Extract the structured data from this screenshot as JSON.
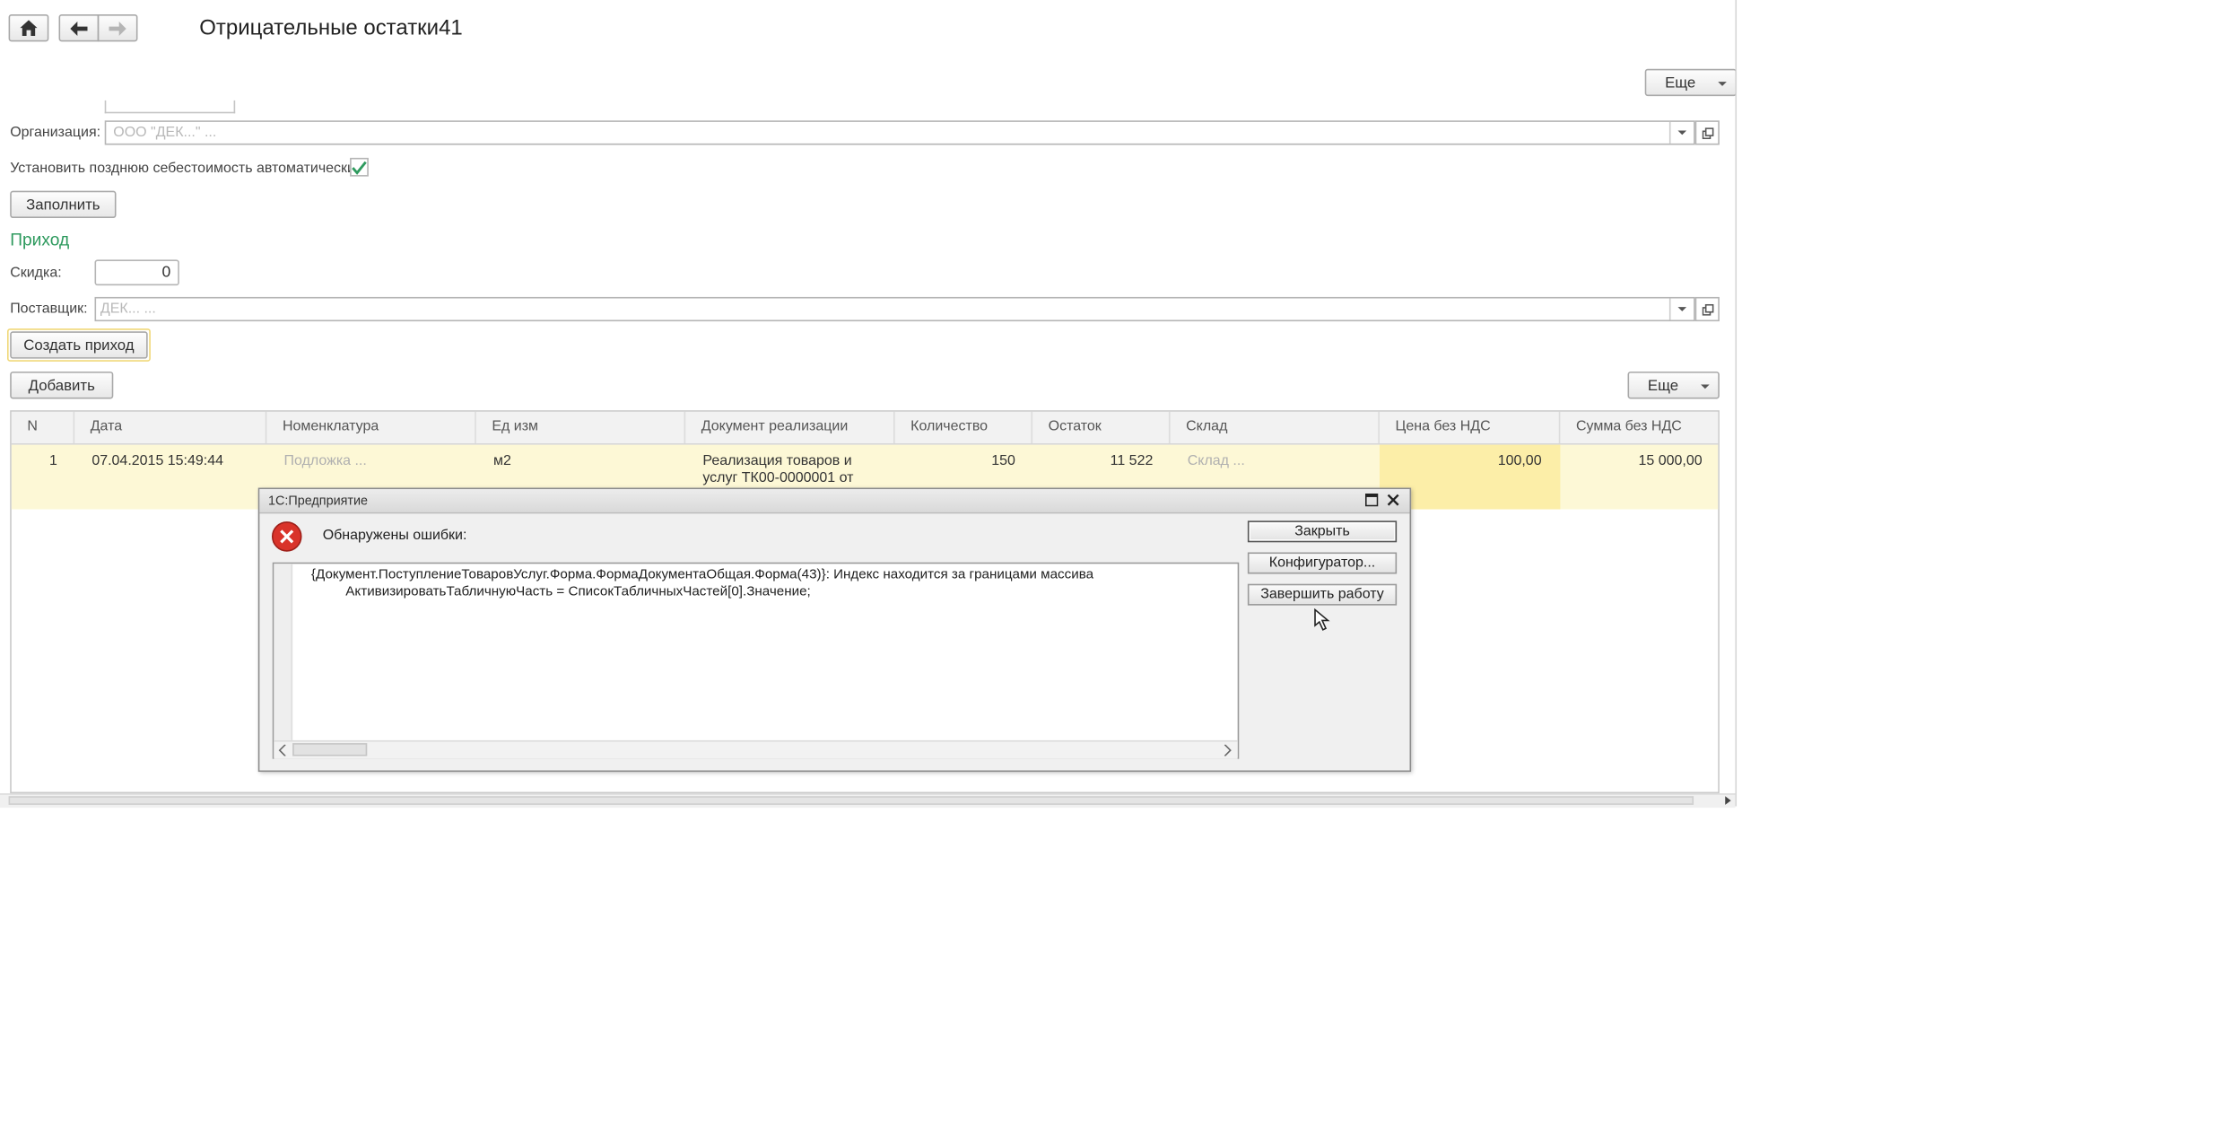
{
  "header": {
    "title": "Отрицательные остатки41",
    "more_label": "Еще"
  },
  "form": {
    "organization_label": "Организация:",
    "organization_value": "ООО \"ДЕК...\" ...",
    "late_cost_label": "Установить позднюю себестоимость автоматически:",
    "late_cost_checked": true,
    "fill_button": "Заполнить",
    "section_title": "Приход",
    "discount_label": "Скидка:",
    "discount_value": "0",
    "supplier_label": "Поставщик:",
    "supplier_value": "ДЕК... ...",
    "create_receipt_button": "Создать приход"
  },
  "table_toolbar": {
    "add_button": "Добавить",
    "more_label": "Еще"
  },
  "table": {
    "columns": [
      "N",
      "Дата",
      "Номенклатура",
      "Ед изм",
      "Документ реализации",
      "Количество",
      "Остаток",
      "Склад",
      "Цена без НДС",
      "Сумма без НДС"
    ],
    "rows": [
      {
        "n": "1",
        "date": "07.04.2015 15:49:44",
        "item": "Подложка ...",
        "unit": "м2",
        "doc": "Реализация товаров и услуг ТК00-0000001 от",
        "qty": "150",
        "stock": "11 522",
        "warehouse": "Склад ...",
        "price": "100,00",
        "sum": "15 000,00"
      }
    ]
  },
  "dialog": {
    "title": "1С:Предприятие",
    "message": "Обнаружены ошибки:",
    "error_line1": "{Документ.ПоступлениеТоваровУслуг.Форма.ФормаДокументаОбщая.Форма(43)}: Индекс находится за границами массива",
    "error_line2": "АктивизироватьТабличнуюЧасть = СписокТабличныхЧастей[0].Значение;",
    "close_button": "Закрыть",
    "configurator_button": "Конфигуратор...",
    "exit_button": "Завершить работу"
  },
  "colors": {
    "section_title": "#2e9a5e",
    "row_highlight": "#fdf8d6",
    "cell_highlight": "#fceea8",
    "error_icon": "#d9332a"
  }
}
